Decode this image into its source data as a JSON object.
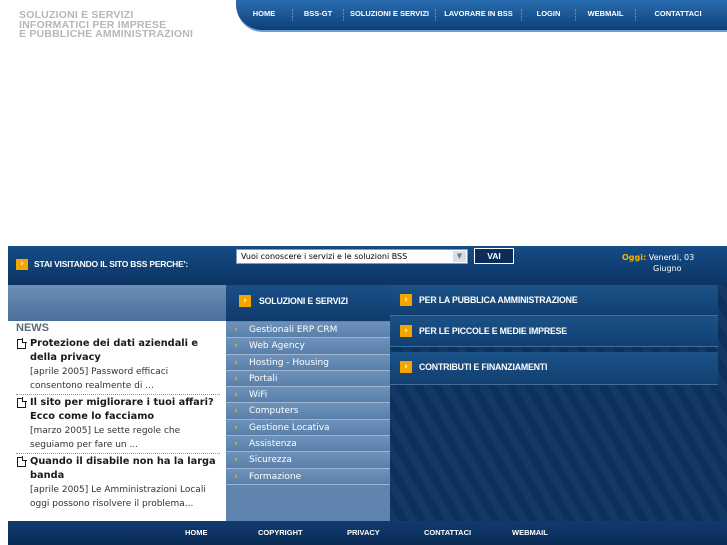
{
  "header": {
    "tagline": [
      "SOLUZIONI E SERVIZI",
      "INFORMATICI PER IMPRESE",
      "E PUBBLICHE AMMINISTRAZIONI"
    ],
    "nav": [
      "HOME",
      "BSS-GT",
      "SOLUZIONI E SERVIZI",
      "LAVORARE IN BSS",
      "LOGIN",
      "WEBMAIL",
      "CONTATTACI"
    ]
  },
  "visit": {
    "label": "STAI VISITANDO IL SITO BSS PERCHE':",
    "select_value": "Vuoi conoscere i servizi e le soluzioni BSS",
    "button": "VAI",
    "today_label": "Oggi:",
    "date_line1": "Venerdi, 03",
    "date_line2": "Giugno"
  },
  "news": {
    "title": "NEWS",
    "items": [
      {
        "headline": "Protezione dei dati aziendali e della privacy",
        "body": "[aprile 2005] Password efficaci consentono realmente di ..."
      },
      {
        "headline": "Il sito per migliorare i tuoi affari? Ecco come lo facciamo",
        "body": "[marzo 2005] Le sette regole che seguiamo per fare un ..."
      },
      {
        "headline": "Quando il disabile non ha la larga banda",
        "body": "[aprile 2005] Le Amministrazioni Locali oggi possono risolvere il problema..."
      }
    ]
  },
  "services": {
    "title": "SOLUZIONI E SERVIZI",
    "items": [
      "Gestionali ERP CRM",
      "Web Agency",
      "Hosting - Housing",
      "Portali",
      "WiFi",
      "Computers",
      "Gestione Locativa",
      "Assistenza",
      "Sicurezza",
      "Formazione"
    ]
  },
  "sections": [
    "PER LA PUBBLICA AMMINISTRAZIONE",
    "PER LE PICCOLE E MEDIE IMPRESE",
    "CONTRIBUTI E FINANZIAMENTI"
  ],
  "footer": [
    "HOME",
    "COPYRIGHT",
    "PRIVACY",
    "CONTATTACI",
    "WEBMAIL"
  ],
  "colors": {
    "navy": "#0d3460",
    "accent_orange": "#f5a400",
    "mid_blue": "#5f84ad"
  }
}
